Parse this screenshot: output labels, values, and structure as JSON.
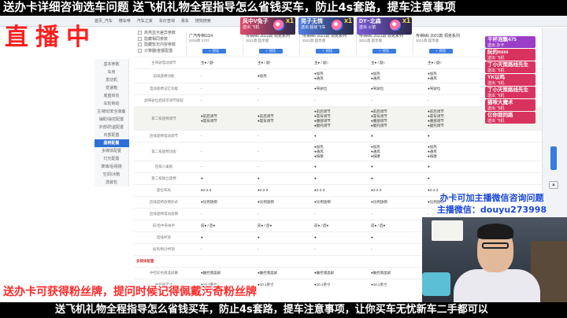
{
  "banner_top": "送办卡详细咨询选车问题  送飞机礼物全程指导怎么省钱买车，防止4s套路，提车注意事项",
  "banner_bottom": "送飞机礼物全程指导怎么省钱买车，防止4s套路，提车注意事项，让你买车无忧新车二手都可以",
  "live_label": "直播中",
  "fans_overlay": "送办卡可获得粉丝牌，提问时候记得佩戴污奇粉丝牌",
  "contact": {
    "line1": "办卡可加主播微信咨询问题",
    "line2": "主播微信：douyu273998"
  },
  "browser_tabs": [
    "首页_汽车",
    "懂车帝",
    "汽车之家",
    "车价查询",
    "易车",
    "搜狗搜索"
  ],
  "filters": [
    "高亮显示差异参数",
    "隐藏相同参数",
    "隐藏暂无内容参数",
    "计算器/金额配置"
  ],
  "sidenav": {
    "items": [
      "基本参数",
      "车身",
      "发动机",
      "变速箱",
      "底盘转向",
      "车轮制动",
      "主/被动安全装备",
      "辅助/操控配置",
      "外部/防盗配置",
      "内部配置",
      "座椅配置",
      "多媒体配置",
      "灯光配置",
      "玻璃/后视镜",
      "空调/冰箱",
      "选装包"
    ],
    "active_index": 10
  },
  "columns": [
    {
      "config": "广汽传祺GS4",
      "year": "2019款 270T"
    },
    {
      "config": "传祺M6 2021款 领克系列",
      "year": "2021款 超享版"
    },
    {
      "config": "传祺M6 2021款 领克系列",
      "year": "2021款 超享版"
    },
    {
      "config": "传祺M6 2021款 领克系列",
      "year": "2021款 超享版"
    },
    {
      "config": "传祺M6 2021款 领克系列",
      "year": "2021款 超享版"
    }
  ],
  "add_label": "+ 对比",
  "gifts": [
    {
      "name": "风中V兔子",
      "sub": "送出  飞机",
      "count": "x1",
      "color": "#e24a6d"
    },
    {
      "name": "晃子无情",
      "sub": "送出  超级飞车",
      "count": "x1",
      "color": "#4f7de0"
    },
    {
      "name": "DY~北森",
      "sub": "送出  火箭",
      "count": "x1",
      "color": "#7c5ad8"
    }
  ],
  "fans": [
    {
      "name": "干杯泡飘475",
      "sub": "送出  办卡",
      "color": "#9a3dc8"
    },
    {
      "name": "阮的mini",
      "sub": "送出  飞机",
      "color": "#d8325e"
    },
    {
      "name": "丁小天策路线先生",
      "sub": "送出  飞机",
      "color": "#d8325e"
    },
    {
      "name": "YK以鸣",
      "sub": "送出  飞机",
      "color": "#d8325e"
    },
    {
      "name": "丁小天策路线先生",
      "sub": "送出  飞机",
      "color": "#d8325e"
    },
    {
      "name": "猫咪大魔术",
      "sub": "送出  飞机",
      "color": "#d8325e"
    },
    {
      "name": "亿你我同路",
      "sub": "送出  飞机",
      "color": "#d8325e"
    }
  ],
  "rows": [
    {
      "label": "主驾驶电动调节",
      "values": [
        "主● / 副-",
        "主● / 副-",
        "主● / 副○",
        "主● / 副○",
        "主● / 副○"
      ]
    },
    {
      "label": "前排座椅功能",
      "values": [
        "-",
        "●加热",
        "●加热\n●通风",
        "●加热\n●通风",
        "●加热\n●通风"
      ]
    },
    {
      "label": "电动座椅记忆功能",
      "values": [
        "-",
        "-",
        "●驾驶位",
        "●驾驶位",
        "●驾驶位"
      ]
    },
    {
      "label": "副驾驶位后排可调节按钮",
      "values": [
        "-",
        "-",
        "-",
        "-",
        "-"
      ]
    },
    {
      "label": "第二排座椅调节",
      "values": [
        "●前后调节\n●靠背调节",
        "●前后调节\n●靠背调节",
        "●前后调节\n●靠背调节\n●腰部调节\n●腿托调节",
        "●前后调节\n●靠背调节\n●腰部调节\n●腿托调节",
        "●前后调节\n●靠背调节\n●腰部调节\n●腿托调节"
      ]
    },
    {
      "label": "后排座椅电动调节",
      "values": [
        "-",
        "-",
        "●",
        "●",
        "●"
      ]
    },
    {
      "label": "第二排座椅功能",
      "values": [
        "-",
        "-",
        "●加热\n●通风\n●按摩",
        "●加热\n●通风\n●按摩",
        "●加热\n●通风\n●按摩"
      ]
    },
    {
      "label": "后排小桌板",
      "values": [
        "-",
        "-",
        "●",
        "●",
        "●"
      ]
    },
    {
      "label": "第二排独立座椅",
      "values": [
        "●",
        "●",
        "●",
        "●",
        "●"
      ]
    },
    {
      "label": "座位布局",
      "values": [
        "●2-2-3",
        "●2-2-3",
        "●2-2-3",
        "●2-2-3",
        "●2-2-3"
      ]
    },
    {
      "label": "后排座椅放倒形式",
      "values": [
        "●比例放倒",
        "●比例放倒",
        "●比例放倒",
        "●比例放倒",
        "●比例放倒"
      ]
    },
    {
      "label": "后排座椅电动放倒",
      "values": [
        "-",
        "-",
        "-",
        "-",
        "-"
      ]
    },
    {
      "label": "前/后中央扶手",
      "values": [
        "前● / 后●",
        "前● / 后●",
        "前● / 后●",
        "前● / 后●",
        "前● / 后●"
      ]
    },
    {
      "label": "后排杯架",
      "values": [
        "●",
        "●",
        "●",
        "●",
        "●"
      ]
    },
    {
      "label": "加热/制冷杯架",
      "values": [
        "-",
        "-",
        "-",
        "-",
        "-"
      ]
    },
    {
      "label": "多媒体配置",
      "section": true,
      "values": []
    },
    {
      "label": "中控彩色液晶屏幕",
      "values": [
        "●触控液晶屏",
        "●触控液晶屏",
        "●触控液晶屏",
        "●触控液晶屏",
        "●触控液晶屏"
      ]
    },
    {
      "label": "中控屏尺寸",
      "values": [
        "●10.1英寸",
        "●10.1英寸",
        "●10.1英寸",
        "●10.1英寸",
        "●10.1英寸"
      ]
    }
  ]
}
